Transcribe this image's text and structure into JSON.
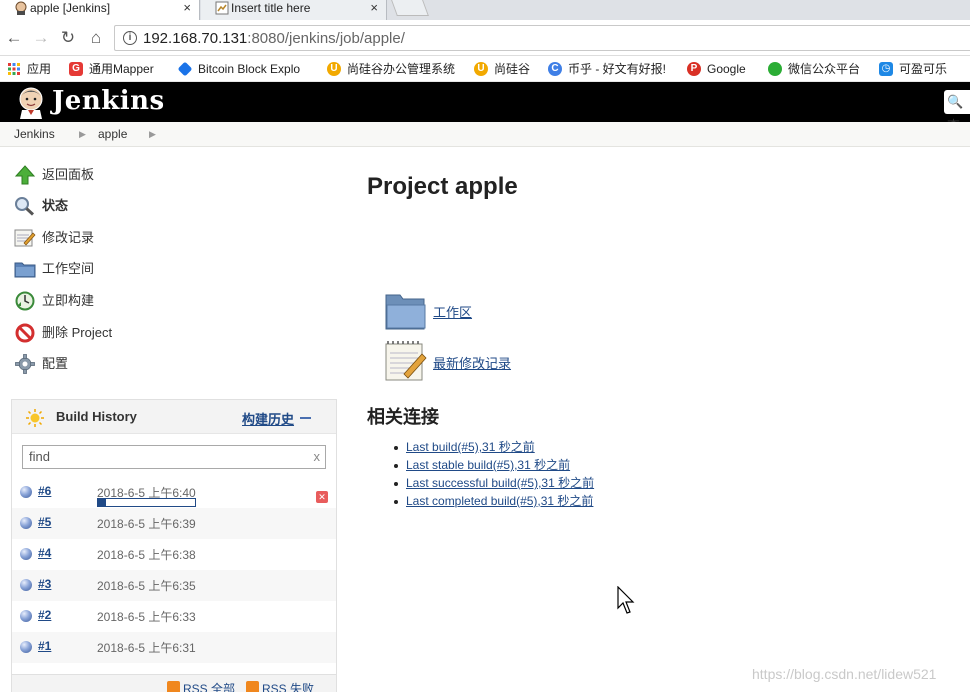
{
  "browser": {
    "tabs": [
      {
        "title": "apple [Jenkins]",
        "close": "×"
      },
      {
        "title": "Insert title here",
        "close": "×"
      }
    ],
    "url_host": "192.168.70.131",
    "url_rest": ":8080/jenkins/job/apple/",
    "bookmarks": [
      {
        "label": "应用",
        "icon": "apps-icon",
        "color": "#4285f4"
      },
      {
        "label": "通用Mapper",
        "icon": "g-icon",
        "color": "#e53935"
      },
      {
        "label": "Bitcoin Block Explo",
        "icon": "diamond-icon",
        "color": "#1a73e8"
      },
      {
        "label": "尚硅谷办公管理系统",
        "icon": "u-icon",
        "color": "#f2a900"
      },
      {
        "label": "尚硅谷",
        "icon": "u-icon",
        "color": "#f2a900"
      },
      {
        "label": "币乎 - 好文有好报!",
        "icon": "c-icon",
        "color": "#3f7fe6"
      },
      {
        "label": "Google",
        "icon": "p-icon",
        "color": "#d93025"
      },
      {
        "label": "微信公众平台",
        "icon": "wechat-icon",
        "color": "#2bad35"
      },
      {
        "label": "可盈可乐",
        "icon": "clock-icon",
        "color": "#1e88e5"
      }
    ]
  },
  "jenkins": {
    "title": "Jenkins",
    "search_glyph": "查",
    "breadcrumb": [
      "Jenkins",
      "apple"
    ],
    "tasks": [
      {
        "label": "返回面板",
        "icon": "up-arrow-icon"
      },
      {
        "label": "状态",
        "icon": "magnifier-icon"
      },
      {
        "label": "修改记录",
        "icon": "notepad-icon"
      },
      {
        "label": "工作空间",
        "icon": "folder-icon"
      },
      {
        "label": "立即构建",
        "icon": "clock-build-icon"
      },
      {
        "label": "删除 Project",
        "icon": "no-entry-icon"
      },
      {
        "label": "配置",
        "icon": "gear-icon"
      }
    ],
    "build_history": {
      "title": "Build History",
      "trend_label": "构建历史",
      "find_placeholder": "find",
      "find_clear": "x",
      "builds": [
        {
          "number": "#6",
          "date": "2018-6-5 上午6:40",
          "in_progress": true,
          "progress": 0.08
        },
        {
          "number": "#5",
          "date": "2018-6-5 上午6:39"
        },
        {
          "number": "#4",
          "date": "2018-6-5 上午6:38"
        },
        {
          "number": "#3",
          "date": "2018-6-5 上午6:35"
        },
        {
          "number": "#2",
          "date": "2018-6-5 上午6:33"
        },
        {
          "number": "#1",
          "date": "2018-6-5 上午6:31"
        }
      ],
      "rss_all": "RSS 全部",
      "rss_failed": "RSS 失败"
    },
    "main": {
      "title": "Project apple",
      "workspace_link": "工作区",
      "changes_link": "最新修改记录",
      "permalinks_title": "相关连接",
      "permalinks": [
        "Last build(#5),31 秒之前",
        "Last stable build(#5),31 秒之前",
        "Last successful build(#5),31 秒之前",
        "Last completed build(#5),31 秒之前"
      ]
    }
  },
  "watermark": "https://blog.csdn.net/lidew521"
}
